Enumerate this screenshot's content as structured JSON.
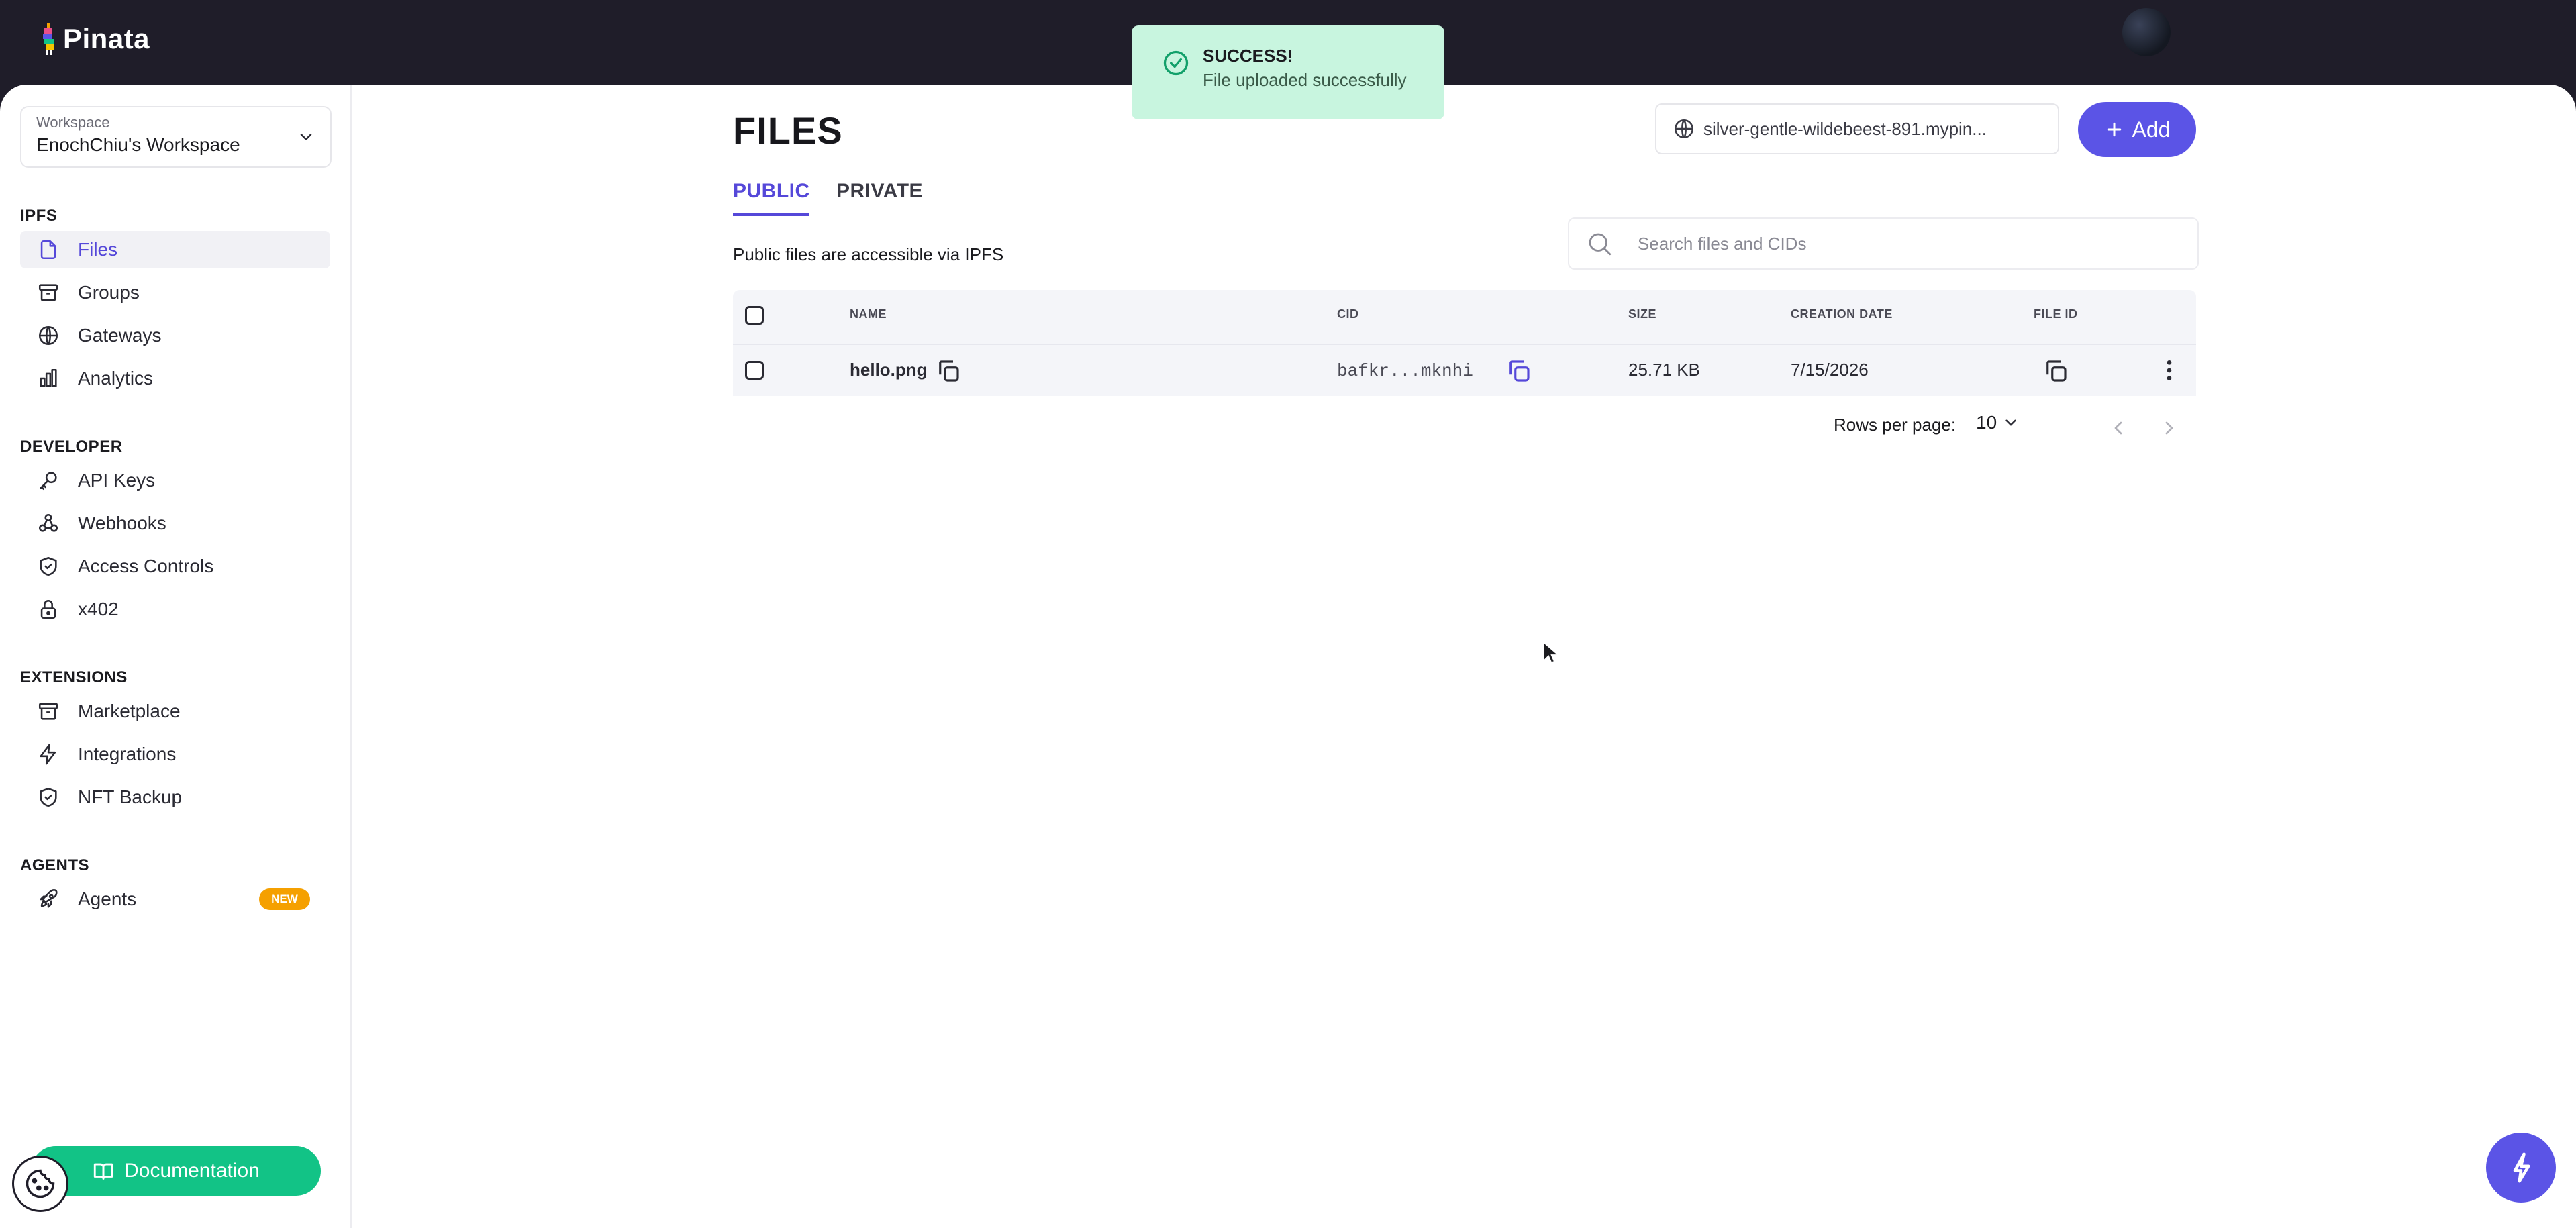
{
  "app": {
    "name": "Pinata"
  },
  "toast": {
    "title": "SUCCESS!",
    "message": "File uploaded successfully"
  },
  "workspace": {
    "label": "Workspace",
    "name": "EnochChiu's Workspace"
  },
  "sidebar": {
    "sections": [
      {
        "title": "IPFS",
        "items": [
          {
            "label": "Files",
            "icon": "file-icon",
            "active": true
          },
          {
            "label": "Groups",
            "icon": "archive-icon"
          },
          {
            "label": "Gateways",
            "icon": "globe-icon"
          },
          {
            "label": "Analytics",
            "icon": "bar-chart-icon"
          }
        ]
      },
      {
        "title": "DEVELOPER",
        "items": [
          {
            "label": "API Keys",
            "icon": "key-icon"
          },
          {
            "label": "Webhooks",
            "icon": "webhook-icon"
          },
          {
            "label": "Access Controls",
            "icon": "shield-check-icon"
          },
          {
            "label": "x402",
            "icon": "lock-icon"
          }
        ]
      },
      {
        "title": "EXTENSIONS",
        "items": [
          {
            "label": "Marketplace",
            "icon": "archive-icon"
          },
          {
            "label": "Integrations",
            "icon": "lightning-icon"
          },
          {
            "label": "NFT Backup",
            "icon": "shield-check-icon"
          }
        ]
      },
      {
        "title": "AGENTS",
        "items": [
          {
            "label": "Agents",
            "icon": "rocket-icon",
            "badge": "NEW"
          }
        ]
      }
    ],
    "documentation_label": "Documentation"
  },
  "main": {
    "title": "FILES",
    "gateway": "silver-gentle-wildebeest-891.mypin...",
    "add_label": "Add",
    "tabs": [
      {
        "label": "PUBLIC",
        "active": true
      },
      {
        "label": "PRIVATE"
      }
    ],
    "subtitle": "Public files are accessible via IPFS",
    "search_placeholder": "Search files and CIDs",
    "table": {
      "columns": [
        "NAME",
        "CID",
        "SIZE",
        "CREATION DATE",
        "FILE ID"
      ],
      "rows": [
        {
          "name": "hello.png",
          "cid": "bafkr...mknhi",
          "size": "25.71 KB",
          "date": "7/15/2026"
        }
      ]
    },
    "pagination": {
      "rows_per_page_label": "Rows per page:",
      "rows_per_page": "10"
    }
  },
  "colors": {
    "accent": "#5b54e6",
    "toast_bg": "#c8f5df",
    "doc_button": "#12c386",
    "badge": "#f5a000",
    "topbar": "#1f1d29"
  }
}
